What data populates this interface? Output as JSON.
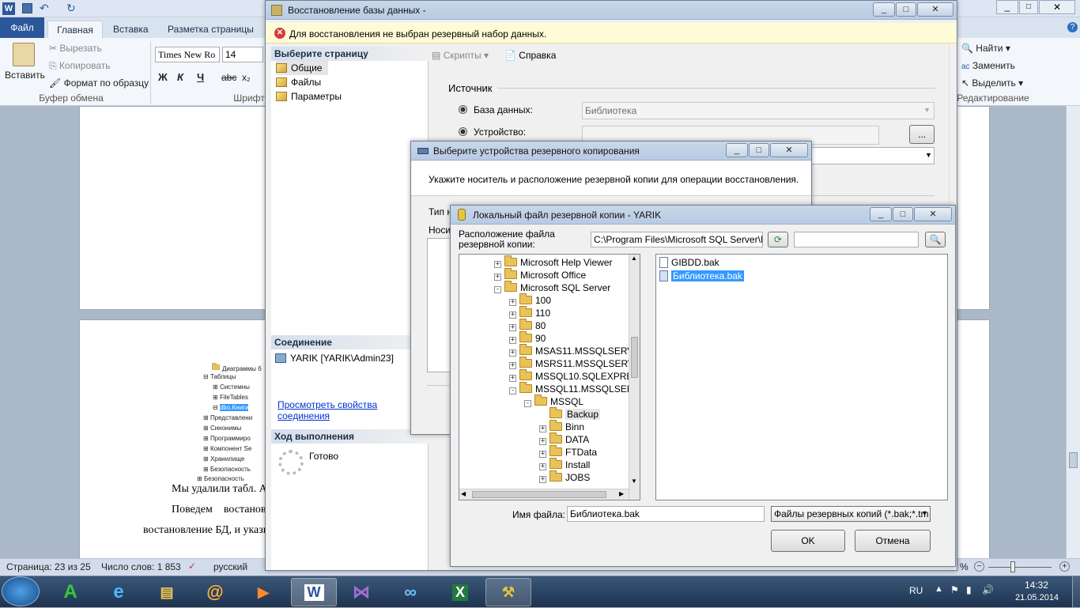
{
  "word": {
    "tabs": {
      "file": "Файл",
      "home": "Главная",
      "insert": "Вставка",
      "layout": "Разметка страницы"
    },
    "clipboard": {
      "paste": "Вставить",
      "cut": "Вырезать",
      "copy": "Копировать",
      "format_painter": "Формат по образцу",
      "group": "Буфер обмена"
    },
    "font": {
      "name": "Times New Ro",
      "size": "14",
      "group": "Шрифт",
      "bold": "Ж",
      "italic": "К",
      "underline": "Ч",
      "strike": "abc",
      "subscript": "x₂"
    },
    "editing": {
      "find": "Найти",
      "replace": "Заменить",
      "select": "Выделить",
      "group": "Редактирование"
    },
    "tree_items": [
      "Диаграммы б",
      "Таблицы",
      "Системны",
      "FileTables",
      "dbo.Книги",
      "Представлени",
      "Синонимы",
      "Программиро",
      "Компонент Se",
      "Хранилище",
      "Безопасность",
      "Безопасность"
    ],
    "doc_lines": [
      "Мы удалили табл. А",
      "Поведем    востанова",
      "востановление БД, и указы"
    ],
    "status": {
      "page": "Страница: 23 из 25",
      "words": "Число слов: 1 853",
      "lang": "русский",
      "zoom": "%"
    }
  },
  "restore_dialog": {
    "title": "Восстановление базы данных -",
    "error": "Для восстановления не выбран резервный набор данных.",
    "select_page_header": "Выберите страницу",
    "pages": [
      "Общие",
      "Файлы",
      "Параметры"
    ],
    "toolbar": {
      "scripts": "Скрипты",
      "help": "Справка"
    },
    "source_header": "Источник",
    "db_label": "База данных:",
    "db_value": "Библиотека",
    "device_label": "Устройство:",
    "device_browse": "...",
    "connection_header": "Соединение",
    "connection_value": "YARIK [YARIK\\Admin23]",
    "view_props_line1": "Просмотреть свойства",
    "view_props_line2": "соединения",
    "progress_header": "Ход выполнения",
    "progress_status": "Готово"
  },
  "backup_devices_dialog": {
    "title": "Выберите устройства резервного копирования",
    "desc": "Укажите носитель и расположение резервной копии для операции восстановления.",
    "type_label": "Тип н",
    "media_label": "Носи"
  },
  "local_file_dialog": {
    "title": "Локальный файл резервной копии - YARIK",
    "location_label_1": "Расположение файла",
    "location_label_2": "резервной копии:",
    "location_value": "C:\\Program Files\\Microsoft SQL Server\\MSS",
    "tree": [
      {
        "label": "Microsoft Help Viewer",
        "exp": "+",
        "level": 0
      },
      {
        "label": "Microsoft Office",
        "exp": "+",
        "level": 0
      },
      {
        "label": "Microsoft SQL Server",
        "exp": "−",
        "level": 0
      },
      {
        "label": "100",
        "exp": "+",
        "level": 1
      },
      {
        "label": "110",
        "exp": "+",
        "level": 1
      },
      {
        "label": "80",
        "exp": "+",
        "level": 1
      },
      {
        "label": "90",
        "exp": "+",
        "level": 1
      },
      {
        "label": "MSAS11.MSSQLSERVER",
        "exp": "+",
        "level": 1
      },
      {
        "label": "MSRS11.MSSQLSERVER",
        "exp": "+",
        "level": 1
      },
      {
        "label": "MSSQL10.SQLEXPRESS",
        "exp": "+",
        "level": 1
      },
      {
        "label": "MSSQL11.MSSQLSERVER",
        "exp": "−",
        "level": 1
      },
      {
        "label": "MSSQL",
        "exp": "−",
        "level": 2
      },
      {
        "label": "Backup",
        "exp": "",
        "level": 3
      },
      {
        "label": "Binn",
        "exp": "+",
        "level": 3
      },
      {
        "label": "DATA",
        "exp": "+",
        "level": 3
      },
      {
        "label": "FTData",
        "exp": "+",
        "level": 3
      },
      {
        "label": "Install",
        "exp": "+",
        "level": 3
      },
      {
        "label": "JOBS",
        "exp": "+",
        "level": 3
      }
    ],
    "files": [
      "GIBDD.bak",
      "Библиотека.bak"
    ],
    "filename_label": "Имя файла:",
    "filename_value": "Библиотека.bak",
    "filter_value": "Файлы резервных копий (*.bak;*.tm",
    "ok": "OK",
    "cancel": "Отмена"
  },
  "taskbar": {
    "lang": "RU",
    "time": "14:32",
    "date": "21.05.2014"
  },
  "colors": {
    "accent": "#2b579a",
    "selection": "#3399ff",
    "error_bg": "#fffbd6"
  }
}
